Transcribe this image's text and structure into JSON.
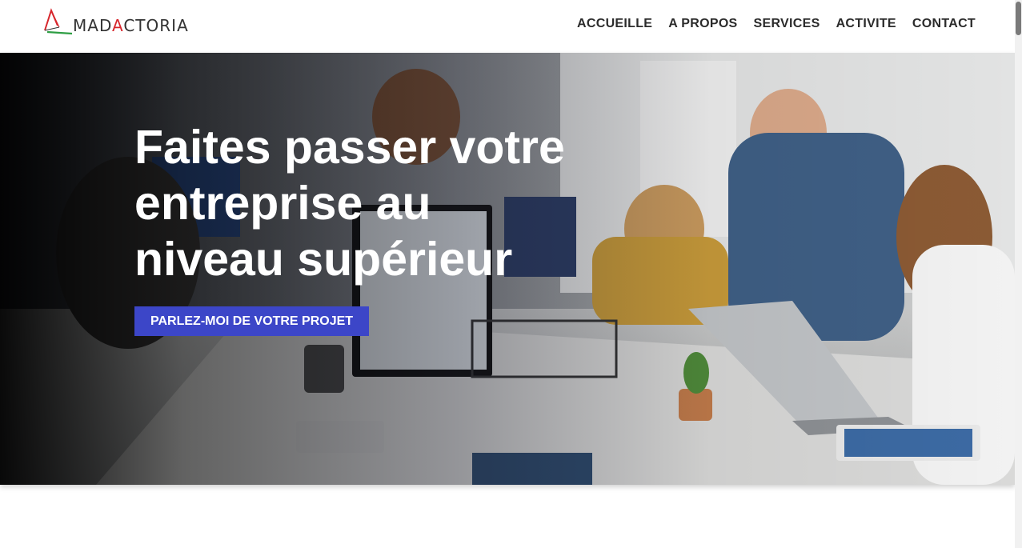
{
  "header": {
    "logo": {
      "text_left": "MAD",
      "text_accent": "A",
      "text_right": "CTORIA"
    },
    "nav": [
      "ACCUEILLE",
      "A PROPOS",
      "SERVICES",
      "ACTIVITE",
      "CONTACT"
    ]
  },
  "hero": {
    "title_lines": [
      "Faites passer votre",
      "entreprise au",
      "niveau supérieur"
    ],
    "cta_label": "PARLEZ-MOI DE VOTRE PROJET",
    "cta_color": "#3c46c8"
  },
  "colors": {
    "logo_red": "#d7262c",
    "logo_green": "#2e9e44",
    "nav_text": "#2b2b2b"
  },
  "icons": {
    "logo_mark": "mountain-peaks-logo-icon"
  }
}
